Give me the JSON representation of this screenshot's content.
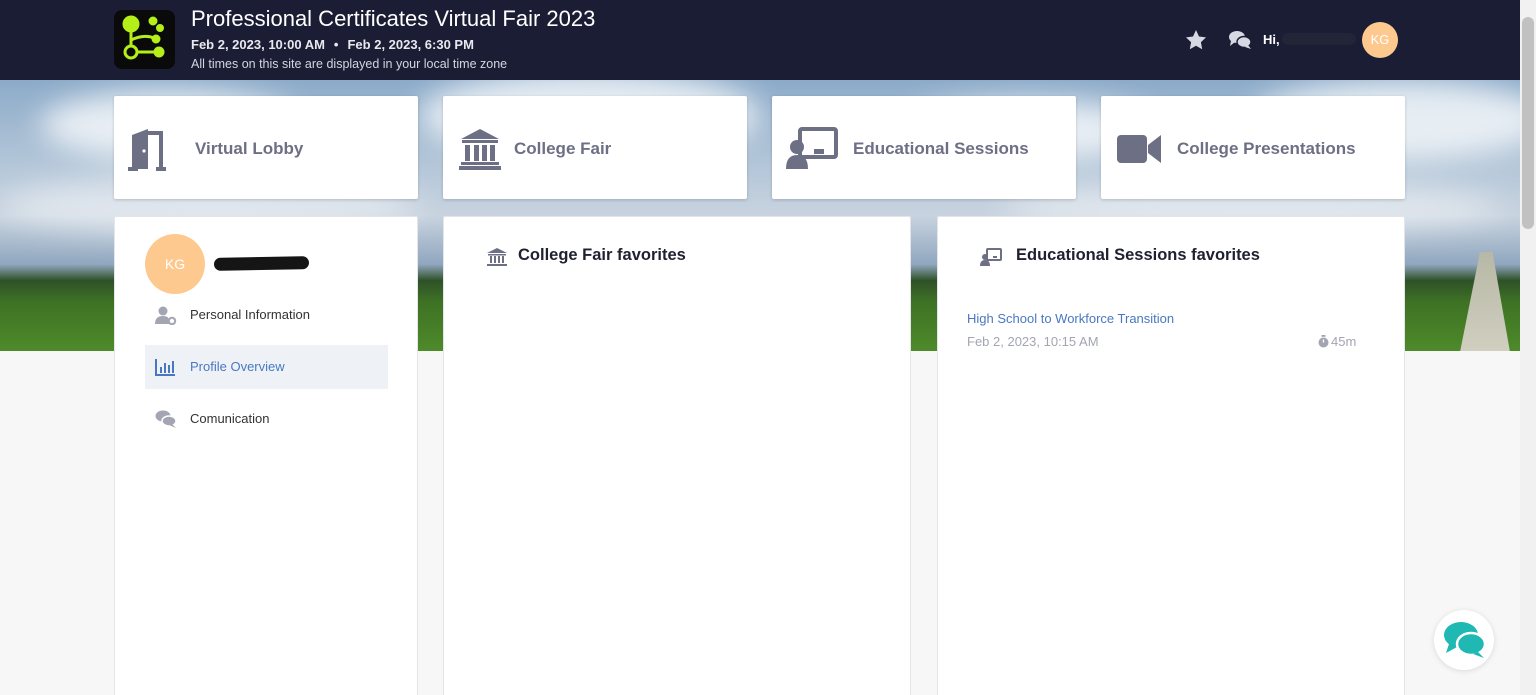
{
  "header": {
    "title": "Professional Certificates Virtual Fair 2023",
    "start": "Feb 2, 2023, 10:00 AM",
    "separator": "•",
    "end": "Feb 2, 2023, 6:30 PM",
    "timezone_note": "All times on this site are displayed in your local time zone",
    "greeting": "Hi,",
    "initials": "KG",
    "favorites_icon": "star-icon",
    "messages_icon": "chat-bubbles-icon"
  },
  "nav": [
    {
      "label": "Virtual Lobby",
      "icon": "door-icon"
    },
    {
      "label": "College Fair",
      "icon": "institution-icon"
    },
    {
      "label": "Educational Sessions",
      "icon": "presenter-board-icon"
    },
    {
      "label": "College Presentations",
      "icon": "video-camera-icon"
    }
  ],
  "profile": {
    "initials": "KG",
    "menu": [
      {
        "label": "Personal Information",
        "icon": "user-gear-icon",
        "active": false
      },
      {
        "label": "Profile Overview",
        "icon": "bar-chart-icon",
        "active": true
      },
      {
        "label": "Comunication",
        "icon": "chat-bubbles-icon",
        "active": false
      }
    ]
  },
  "college_fair_favorites": {
    "title": "College Fair favorites"
  },
  "educational_sessions_favorites": {
    "title": "Educational Sessions favorites",
    "items": [
      {
        "title": "High School to Workforce Transition",
        "date": "Feb 2, 2023, 10:15 AM",
        "duration": "45m"
      }
    ]
  },
  "colors": {
    "header_bg": "#1b1d35",
    "accent_link": "#4a78c0",
    "avatar": "#fec98e",
    "logo_green": "#b4ef1a",
    "chat_teal": "#1fb8b3"
  }
}
